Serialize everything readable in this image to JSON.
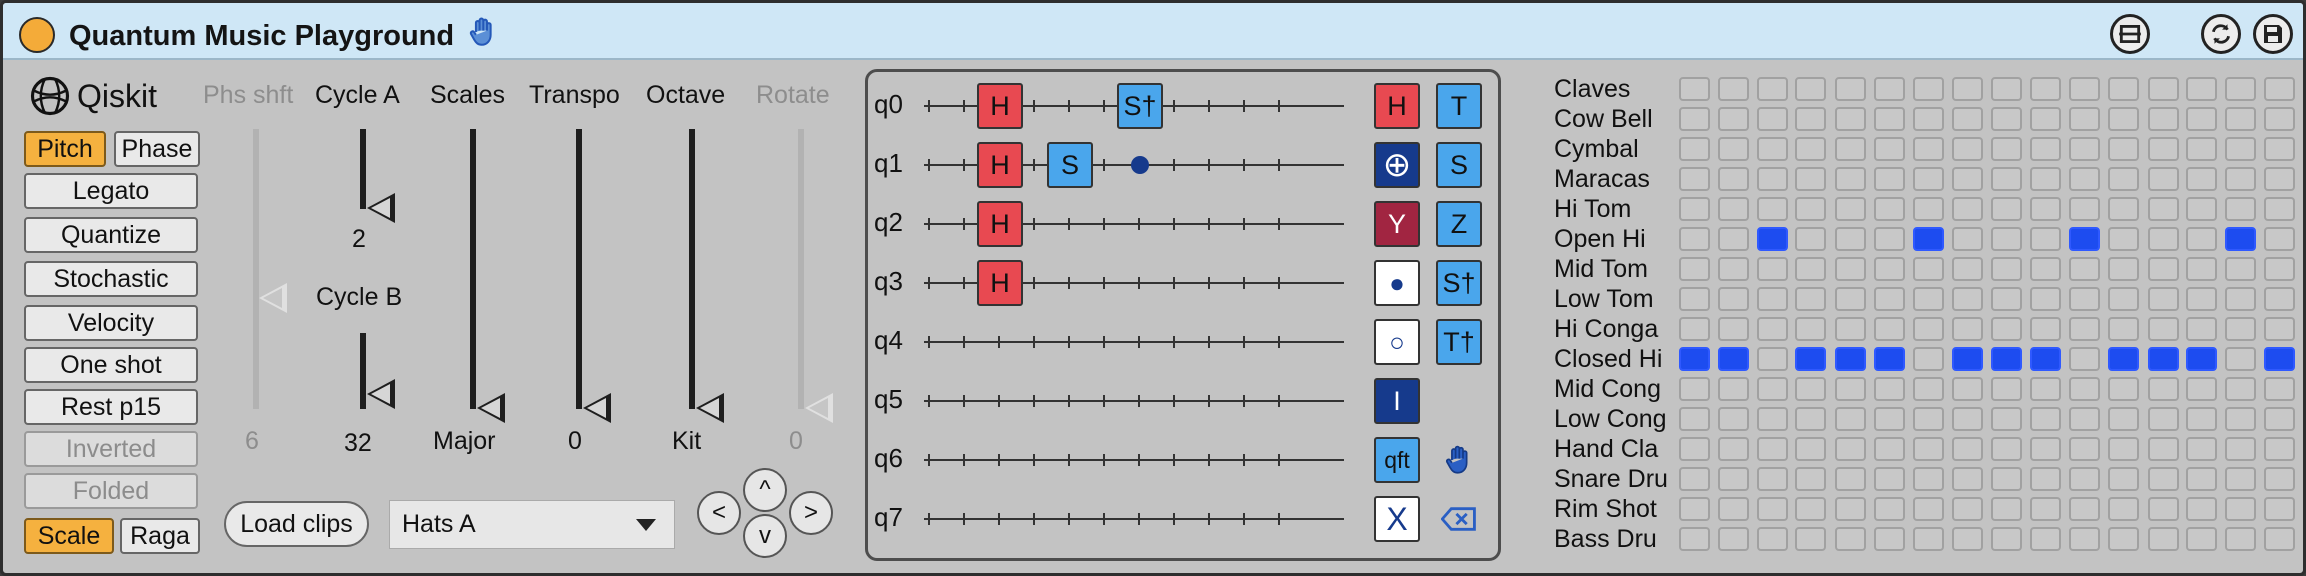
{
  "window": {
    "title": "Quantum Music Playground",
    "icons": {
      "title_icon": "hand-icon",
      "buttons": [
        "hotswap-icon",
        "refresh-icon",
        "save-icon"
      ]
    }
  },
  "left": {
    "logo_label": "Qiskit",
    "pitch": "Pitch",
    "phase": "Phase",
    "toggles": [
      "Legato",
      "Quantize",
      "Stochastic",
      "Velocity",
      "One shot",
      "Rest p15",
      "Inverted",
      "Folded"
    ],
    "toggles_active": [
      true,
      true,
      true,
      true,
      true,
      true,
      false,
      false
    ],
    "scale": "Scale",
    "raga": "Raga"
  },
  "sliders": {
    "phs_shft": {
      "label": "Phs shft",
      "value": "6"
    },
    "cycle_a": {
      "label": "Cycle A",
      "value": "2"
    },
    "cycle_b": {
      "label": "Cycle B",
      "value": "32"
    },
    "scales": {
      "label": "Scales",
      "value": "Major"
    },
    "transpo": {
      "label": "Transpo",
      "value": "0"
    },
    "octave": {
      "label": "Octave",
      "value": "Kit"
    },
    "rotate": {
      "label": "Rotate",
      "value": "0"
    }
  },
  "controls": {
    "load_clips": "Load clips",
    "dropdown_value": "Hats A",
    "nav": {
      "left": "<",
      "up": "^",
      "right": ">",
      "down": "v"
    }
  },
  "circuit": {
    "qubits": [
      "q0",
      "q1",
      "q2",
      "q3",
      "q4",
      "q5",
      "q6",
      "q7"
    ],
    "gates": [
      {
        "qubit": 0,
        "col": 2,
        "label": "H",
        "color": "red"
      },
      {
        "qubit": 0,
        "col": 6,
        "label": "S†",
        "color": "blue"
      },
      {
        "qubit": 1,
        "col": 2,
        "label": "H",
        "color": "red"
      },
      {
        "qubit": 1,
        "col": 4,
        "label": "S",
        "color": "blue"
      },
      {
        "qubit": 2,
        "col": 2,
        "label": "H",
        "color": "red"
      },
      {
        "qubit": 3,
        "col": 2,
        "label": "H",
        "color": "red"
      }
    ],
    "control_dots": [
      {
        "qubit": 1,
        "col": 6
      }
    ]
  },
  "palette": [
    {
      "label": "H",
      "color": "red"
    },
    {
      "label": "T",
      "color": "blue"
    },
    {
      "label": "⊕",
      "color": "navy"
    },
    {
      "label": "S",
      "color": "blue"
    },
    {
      "label": "Y",
      "color": "maroon"
    },
    {
      "label": "Z",
      "color": "blue"
    },
    {
      "label": "●",
      "color": "white"
    },
    {
      "label": "S†",
      "color": "blue"
    },
    {
      "label": "○",
      "color": "white"
    },
    {
      "label": "T†",
      "color": "blue"
    },
    {
      "label": "I",
      "color": "navy"
    },
    {
      "label": "",
      "color": "none"
    },
    {
      "label": "qft",
      "color": "blue"
    },
    {
      "label": "hand-icon",
      "color": "none"
    },
    {
      "label": "X",
      "color": "white"
    },
    {
      "label": "backspace-icon",
      "color": "none"
    }
  ],
  "drums": {
    "rows": [
      "Claves",
      "Cow Bell",
      "Cymbal",
      "Maracas",
      "Hi Tom",
      "Open Hi",
      "Mid Tom",
      "Low Tom",
      "Hi Conga",
      "Closed Hi",
      "Mid Cong",
      "Low Cong",
      "Hand Cla",
      "Snare Dru",
      "Rim Shot",
      "Bass Dru"
    ],
    "active": {
      "Open Hi": [
        2,
        6,
        10,
        14
      ],
      "Closed Hi": [
        0,
        1,
        3,
        4,
        5,
        7,
        8,
        9,
        11,
        12,
        13,
        15
      ]
    }
  },
  "colors": {
    "accent": "#f5b13f",
    "titlebar": "#cfe7f6",
    "gate_red": "#e84951",
    "gate_blue": "#4aa6ec",
    "gate_navy": "#163a8c",
    "gate_maroon": "#a12541",
    "step_on": "#1d4cf0"
  }
}
